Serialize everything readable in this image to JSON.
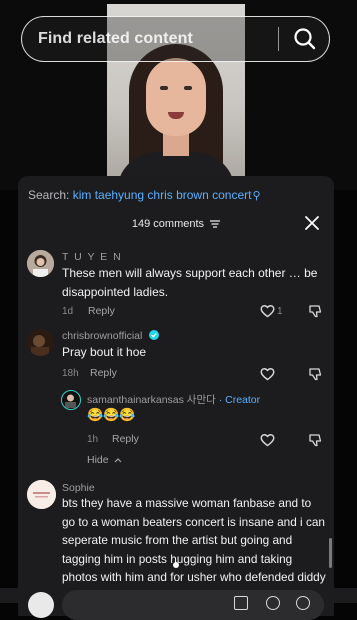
{
  "search": {
    "placeholder": "Find related content"
  },
  "panel": {
    "search_prefix": "Search:",
    "search_query": "kim taehyung chris brown concert",
    "comment_count_label": "149 comments"
  },
  "comments": [
    {
      "username": "T U Y E N",
      "text": "These men will always support each other … be disappointed ladies.",
      "age": "1d",
      "reply_label": "Reply",
      "likes": "1"
    },
    {
      "username": "chrisbrownofficial",
      "verified": true,
      "text": "Pray bout it hoe",
      "age": "18h",
      "reply_label": "Reply"
    },
    {
      "username": "samanthainarkansas 사만다",
      "badge": "· Creator",
      "text": "😂😂😂",
      "age": "1h",
      "reply_label": "Reply",
      "hide_label": "Hide"
    },
    {
      "username": "Sophie",
      "text": "bts they have a massive woman fanbase and to go to a woman beaters concert is insane and i can seperate music from the artist but going and tagging him in posts hugging him and taking photos with him and for usher who defended diddy and bts said it was a honor to"
    }
  ],
  "colors": {
    "accent": "#5ab0ff",
    "panel": "#1c1c1e",
    "background": "#050505"
  }
}
